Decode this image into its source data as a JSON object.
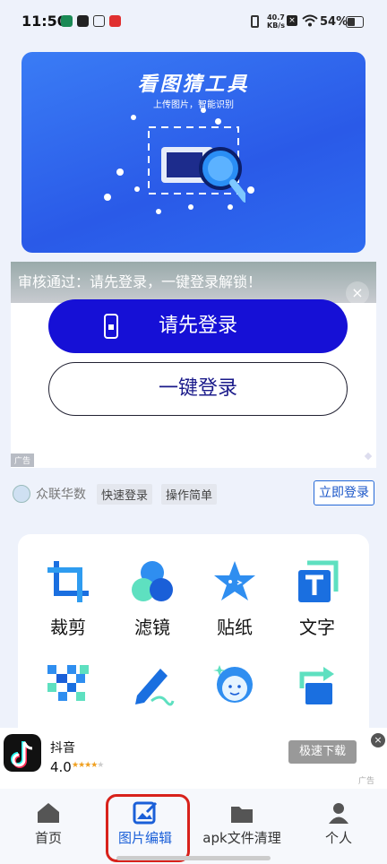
{
  "status_bar": {
    "time": "11:50",
    "net_speed_top": "40.7",
    "net_speed_bottom": "KB/s",
    "battery": "54%"
  },
  "banner": {
    "title": "看图猜工具",
    "subtitle": "上传图片，智能识别"
  },
  "ad": {
    "headline": "审核通过：请先登录，一键登录解锁！",
    "primary_button": "请先登录",
    "secondary_button": "一键登录",
    "close": "×",
    "tag": "广告"
  },
  "sponsor": {
    "name": "众联华数",
    "tags": [
      "快速登录",
      "操作简单"
    ],
    "action": "立即登录"
  },
  "tools": [
    {
      "label": "裁剪",
      "icon": "crop-icon"
    },
    {
      "label": "滤镜",
      "icon": "filter-icon"
    },
    {
      "label": "贴纸",
      "icon": "sticker-icon"
    },
    {
      "label": "文字",
      "icon": "text-icon"
    },
    {
      "label": "",
      "icon": "mosaic-icon"
    },
    {
      "label": "",
      "icon": "pen-icon"
    },
    {
      "label": "",
      "icon": "face-icon"
    },
    {
      "label": "",
      "icon": "rotate-icon"
    }
  ],
  "douyin_ad": {
    "app_name": "抖音",
    "rating": "4.0",
    "stars": 4,
    "download": "极速下载",
    "tag": "广告"
  },
  "nav": {
    "items": [
      "首页",
      "图片编辑",
      "apk文件清理",
      "个人"
    ],
    "active_index": 1
  },
  "colors": {
    "accent": "#2a6ef0",
    "login_button": "#1610d6",
    "highlight": "#d8221b"
  }
}
